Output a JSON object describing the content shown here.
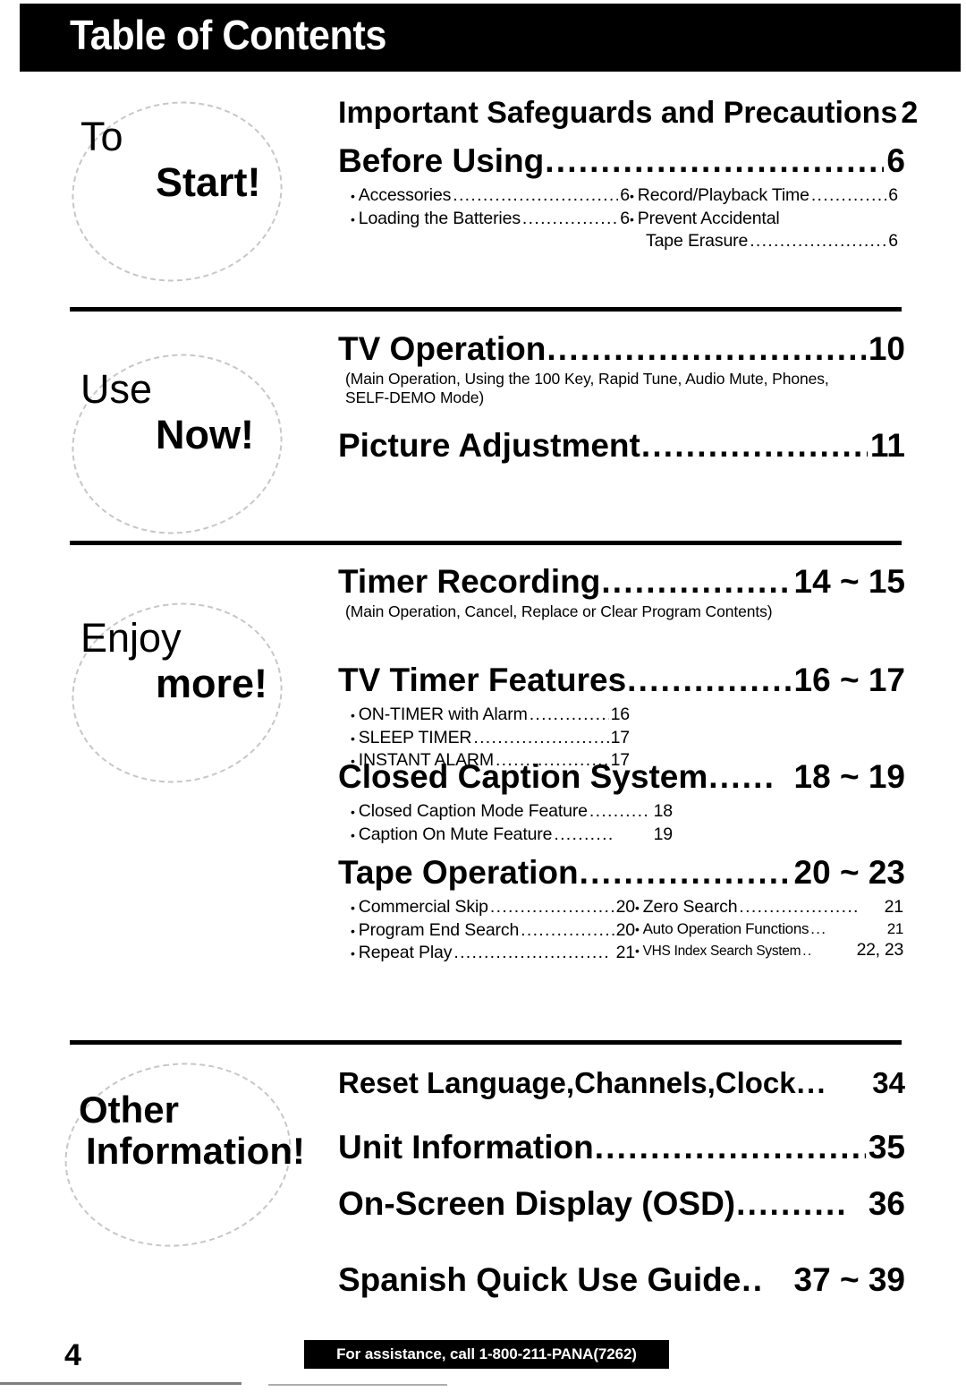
{
  "header": {
    "title": "Table of Contents"
  },
  "sections": [
    {
      "label_line1": "To",
      "label_line2": "Start!",
      "entries": [
        {
          "title": "Important Safeguards and Precautions",
          "page": "2",
          "leader": "..."
        },
        {
          "title": "Before Using",
          "page": "6",
          "leader": "...................................",
          "subs_left": [
            {
              "text": "Accessories",
              "page": "6"
            },
            {
              "text": "Loading the Batteries",
              "page": "6"
            }
          ],
          "subs_right": [
            {
              "text": "Record/Playback Time",
              "page": "6"
            },
            {
              "text": "Prevent Accidental",
              "page": ""
            },
            {
              "text": "Tape Erasure",
              "page": "6"
            }
          ]
        }
      ]
    },
    {
      "label_line1": "Use",
      "label_line2": "Now!",
      "entries": [
        {
          "title": "TV Operation",
          "page": "10",
          "leader": "................................",
          "note": "(Main Operation, Using the 100 Key, Rapid Tune, Audio Mute, Phones, SELF-DEMO Mode)"
        },
        {
          "title": "Picture Adjustment",
          "page": "11",
          "leader": "......................"
        }
      ]
    },
    {
      "label_line1": "Enjoy",
      "label_line2": "more!",
      "entries": [
        {
          "title": "Timer Recording",
          "page": "14 ~ 15",
          "leader": "..................",
          "note": "(Main Operation, Cancel, Replace or Clear Program Contents)"
        },
        {
          "title": "TV Timer Features",
          "page": "16 ~ 17",
          "leader": "...............",
          "subs_left": [
            {
              "text": "ON-TIMER with Alarm",
              "page": "16"
            },
            {
              "text": "SLEEP TIMER",
              "page": "17"
            },
            {
              "text": "INSTANT ALARM",
              "page": "17"
            }
          ]
        },
        {
          "title": "Closed Caption System",
          "page": "18 ~ 19",
          "leader": "......",
          "subs_left": [
            {
              "text": "Closed Caption Mode Feature",
              "page": "18"
            },
            {
              "text": "Caption On Mute Feature",
              "page": "19"
            }
          ]
        },
        {
          "title": "Tape Operation",
          "page": "20 ~ 23",
          "leader": ".....................",
          "subs_left": [
            {
              "text": "Commercial Skip",
              "page": "20"
            },
            {
              "text": "Program End Search",
              "page": "20"
            },
            {
              "text": "Repeat Play",
              "page": "21"
            }
          ],
          "subs_right": [
            {
              "text": "Zero Search",
              "page": "21"
            },
            {
              "text": "Auto Operation Functions",
              "page": "21"
            },
            {
              "text": "VHS Index Search System",
              "page": "22, 23"
            }
          ]
        }
      ]
    },
    {
      "label_line1": "Other",
      "label_line2": "Information!",
      "entries": [
        {
          "title": "Reset Language,Channels,Clock",
          "page": "34",
          "leader": "..."
        },
        {
          "title": "Unit Information",
          "page": "35",
          "leader": "..........................."
        },
        {
          "title": "On-Screen Display (OSD)",
          "page": "36",
          "leader": ".........."
        },
        {
          "title": "Spanish Quick Use Guide",
          "page": "37 ~ 39",
          "leader": ".."
        }
      ]
    }
  ],
  "footer": {
    "page_number": "4",
    "assistance": "For assistance, call 1-800-211-PANA(7262)"
  }
}
